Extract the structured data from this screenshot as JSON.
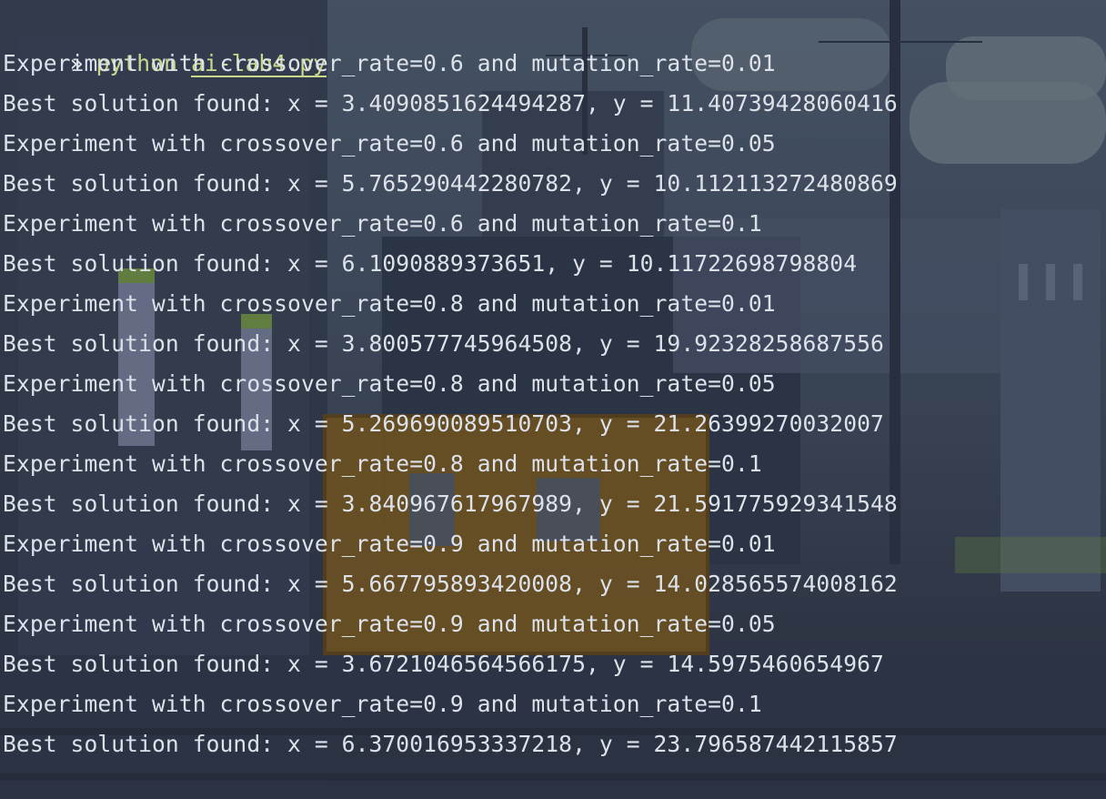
{
  "terminal": {
    "prompt_symbol": "»",
    "command": "python",
    "argument": "ai-lab4.py",
    "output": [
      "Experiment with crossover_rate=0.6 and mutation_rate=0.01",
      "Best solution found: x = 3.4090851624494287, y = 11.40739428060416",
      "Experiment with crossover_rate=0.6 and mutation_rate=0.05",
      "Best solution found: x = 5.765290442280782, y = 10.112113272480869",
      "Experiment with crossover_rate=0.6 and mutation_rate=0.1",
      "Best solution found: x = 6.1090889373651, y = 10.11722698798804",
      "Experiment with crossover_rate=0.8 and mutation_rate=0.01",
      "Best solution found: x = 3.800577745964508, y = 19.92328258687556",
      "Experiment with crossover_rate=0.8 and mutation_rate=0.05",
      "Best solution found: x = 5.269690089510703, y = 21.26399270032007",
      "Experiment with crossover_rate=0.8 and mutation_rate=0.1",
      "Best solution found: x = 3.840967617967989, y = 21.591775929341548",
      "Experiment with crossover_rate=0.9 and mutation_rate=0.01",
      "Best solution found: x = 5.667795893420008, y = 14.028565574008162",
      "Experiment with crossover_rate=0.9 and mutation_rate=0.05",
      "Best solution found: x = 3.6721046564566175, y = 14.5975460654967",
      "Experiment with crossover_rate=0.9 and mutation_rate=0.1",
      "Best solution found: x = 6.370016953337218, y = 23.796587442115857"
    ]
  },
  "colors": {
    "text": "#dde2ea",
    "command": "#c8d78a",
    "background": "#3a4457"
  }
}
